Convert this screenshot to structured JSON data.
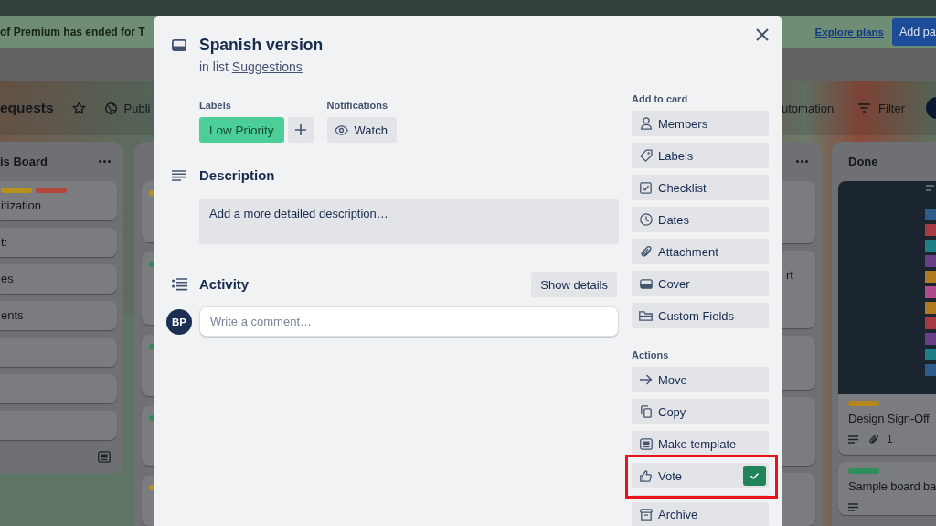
{
  "banner": {
    "text": "of Premium has ended for T",
    "link": "Explore plans",
    "button": "Add pa"
  },
  "board_header": {
    "title": "equests",
    "starred": false,
    "visibility": "Publi",
    "automation": "utomation",
    "filter": "Filter"
  },
  "lists": [
    {
      "title": "is Board",
      "menu": true,
      "cards": [
        {
          "kind": "text",
          "labels": [
            {
              "color": "#b8901c"
            },
            {
              "color": "#b4463a"
            }
          ],
          "title": "itization"
        },
        {
          "kind": "text",
          "title": "t:"
        },
        {
          "kind": "text",
          "title": "es"
        },
        {
          "kind": "text",
          "title": "ents"
        },
        {
          "kind": "blank"
        },
        {
          "kind": "blank"
        },
        {
          "kind": "blank"
        }
      ]
    },
    {
      "menu": false,
      "cards": [
        {
          "kind": "blank",
          "labels": [
            {
              "color": "#b8901c"
            }
          ]
        },
        {
          "kind": "blank",
          "labels": [
            {
              "color": "#2e8b5a"
            }
          ]
        },
        {
          "kind": "blank",
          "labels": [
            {
              "color": "#2e8b5a"
            }
          ]
        },
        {
          "kind": "blank",
          "labels": [
            {
              "color": "#2e8b5a"
            }
          ]
        },
        {
          "kind": "blank",
          "labels": [
            {
              "color": "#b8901c"
            }
          ]
        }
      ]
    },
    {
      "menu": true,
      "cards": [
        {
          "kind": "blank"
        },
        {
          "kind": "text",
          "title": "rt"
        },
        {
          "kind": "blank"
        },
        {
          "kind": "blank"
        },
        {
          "kind": "blank"
        }
      ]
    },
    {
      "title": "Done",
      "menu": false,
      "cards": [
        {
          "kind": "cover",
          "labels": [
            {
              "color": "#b5861c"
            }
          ],
          "title": "Design Sign-Off",
          "description": true,
          "attachments": "1"
        },
        {
          "kind": "text",
          "labels": [
            {
              "color": "#2e8f5a"
            }
          ],
          "title": "Sample board ba",
          "description": true
        }
      ]
    }
  ],
  "card_modal": {
    "title": "Spanish version",
    "list_info": "in list",
    "list_link": "Suggestions",
    "labels_heading": "Labels",
    "labels": [
      {
        "text": "Low Priority",
        "color": "#4bce97"
      }
    ],
    "notifications_heading": "Notifications",
    "watch_button": "Watch",
    "description_heading": "Description",
    "description_placeholder": "Add a more detailed description…",
    "activity_heading": "Activity",
    "details_button": "Show details",
    "user_initials": "BP",
    "comment_placeholder": "Write a comment…",
    "sidebar": [
      {
        "heading": "Add to card",
        "buttons": [
          {
            "label": "Members",
            "highlighted": false
          },
          {
            "label": "Labels",
            "highlighted": false
          },
          {
            "label": "Checklist",
            "highlighted": false
          },
          {
            "label": "Dates",
            "highlighted": false
          },
          {
            "label": "Attachment",
            "highlighted": false
          },
          {
            "label": "Cover",
            "highlighted": false
          },
          {
            "label": "Custom Fields",
            "highlighted": false
          }
        ]
      },
      {
        "heading": "Actions",
        "buttons": [
          {
            "label": "Move",
            "highlighted": false
          },
          {
            "label": "Copy",
            "highlighted": false
          },
          {
            "label": "Make template",
            "highlighted": false
          },
          {
            "label": "Vote",
            "voted": true,
            "highlighted": true
          },
          {
            "label": "Archive",
            "highlighted": false
          }
        ]
      }
    ]
  }
}
